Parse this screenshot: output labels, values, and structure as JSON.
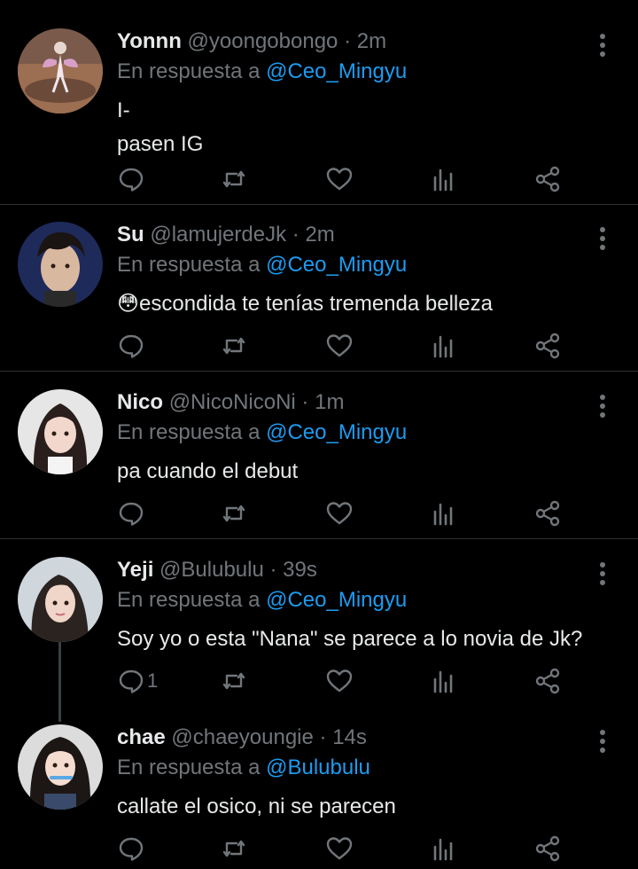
{
  "tweets": [
    {
      "name": "Yonnn",
      "handle": "@yoongobongo",
      "time": "2m",
      "reply_prefix": "En respuesta a",
      "reply_to": "@Ceo_Mingyu",
      "text": "I-\npasen IG",
      "reply_count": ""
    },
    {
      "name": "Su",
      "handle": "@lamujerdeJk",
      "time": "2m",
      "reply_prefix": "En respuesta a",
      "reply_to": "@Ceo_Mingyu",
      "text": "😳escondida te tenías tremenda belleza",
      "reply_count": ""
    },
    {
      "name": "Nico",
      "handle": "@NicoNicoNi",
      "time": "1m",
      "reply_prefix": "En respuesta a",
      "reply_to": "@Ceo_Mingyu",
      "text": "pa cuando el debut",
      "reply_count": ""
    },
    {
      "name": "Yeji",
      "handle": "@Bulubulu",
      "time": "39s",
      "reply_prefix": "En respuesta a",
      "reply_to": "@Ceo_Mingyu",
      "text": "Soy yo o esta \"Nana\" se parece a lo novia de Jk?",
      "reply_count": "1"
    },
    {
      "name": "chae",
      "handle": "@chaeyoungie",
      "time": "14s",
      "reply_prefix": "En respuesta a",
      "reply_to": "@Bulubulu",
      "text": "callate el osico, ni se parecen",
      "reply_count": ""
    }
  ],
  "separator": "·",
  "icons": {
    "more": "more-vertical-icon",
    "reply": "reply-icon",
    "retweet": "retweet-icon",
    "like": "heart-icon",
    "views": "views-icon",
    "share": "share-icon"
  },
  "colors": {
    "background": "#000000",
    "text": "#e7e9ea",
    "muted": "#71767b",
    "link": "#1d9bf0",
    "divider": "#2f3336"
  }
}
